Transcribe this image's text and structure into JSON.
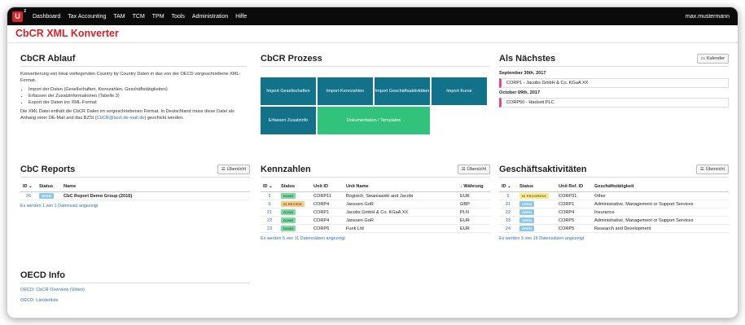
{
  "nav": {
    "logo": "U",
    "logo_sup": "2",
    "items": [
      "Dashboard",
      "Tax Accounting",
      "TAM",
      "TCM",
      "TPM",
      "Tools",
      "Administration",
      "Hilfe"
    ],
    "user": "max.mustermann"
  },
  "page_title": "CbCR XML Konverter",
  "ablauf": {
    "title": "CbCR Ablauf",
    "intro": "Konvertierung von lokal vorliegenden Country by Country Daten in das von der OECD vorgeschriebene XML-Format.",
    "steps": [
      "Import der Daten (Gesellschaften, Kennzahlen, Geschäftstätigkeiten)",
      "Erfassen der Zusatzinformationen (Tabelle 3)",
      "Export der Daten ins XML-Format"
    ],
    "outro_a": "Die XML Datei enthält die CbCR Daten im vorgeschriebenen Format. In Deutschland muss diese Datei als Anhang einer DE-Mail and das BZSt (",
    "outro_link": "CbCR@bzst.de-mail.de",
    "outro_b": ") geschickt werden."
  },
  "prozess": {
    "title": "CbCR Prozess",
    "tiles": [
      "Import Gesellschaften",
      "Import Kennzahlen",
      "Import Geschäftsaktivitäten",
      "Import Kurse",
      "Erfassen Zusatzinfo",
      "Dokumentation / Templates"
    ]
  },
  "naechstes": {
    "title": "Als Nächstes",
    "button": "Kalender",
    "groups": [
      {
        "date": "September 30th, 2017",
        "event": "CORP1 - Jacobs GmbH & Co. KGaA XX"
      },
      {
        "date": "October 09th, 2017",
        "event": "CORP50 - Hackett PLC"
      }
    ]
  },
  "reports": {
    "title": "CbC Reports",
    "button": "Übersicht",
    "columns": [
      "ID",
      "Status",
      "Name"
    ],
    "rows": [
      {
        "id": "26",
        "status": "OPEN",
        "name": "CbC Report Demo Group (2016)"
      }
    ],
    "footer": "Es werden 1 von 1 Datensatz angezeigt"
  },
  "kennzahlen": {
    "title": "Kennzahlen",
    "button": "Übersicht",
    "columns": [
      "ID",
      "Status",
      "Unit ID",
      "Unit Name",
      "Währung"
    ],
    "rows": [
      {
        "id": "5",
        "status": "DONE",
        "unit": "CORP11",
        "name": "Bogisich, Swaniawski and Jacobi",
        "cur": "EUR"
      },
      {
        "id": "6",
        "status": "IN REVIEW",
        "unit": "CORP4",
        "name": "Janssen GoR",
        "cur": "GBP"
      },
      {
        "id": "21",
        "status": "DONE",
        "unit": "CORP1",
        "name": "Jacobs GmbH & Co. KGaA XX",
        "cur": "PLN"
      },
      {
        "id": "22",
        "status": "DONE",
        "unit": "CORP4",
        "name": "Janssen GoR",
        "cur": "EUR"
      },
      {
        "id": "23",
        "status": "DONE",
        "unit": "CORP6",
        "name": "Funk Ltd",
        "cur": "EUR"
      }
    ],
    "footer": "Es werden 5 von 11 Datensätzen angezeigt"
  },
  "aktivitaeten": {
    "title": "Geschäftsaktivitäten",
    "button": "Übersicht",
    "columns": [
      "ID",
      "Status",
      "Unit Ref. ID",
      "Geschäftstätigkeit"
    ],
    "rows": [
      {
        "id": "5",
        "status": "IN PROGRESS",
        "unit": "CORP31",
        "act": "Other"
      },
      {
        "id": "21",
        "status": "OPEN",
        "unit": "CORP1",
        "act": "Administrative, Management or Support Services"
      },
      {
        "id": "22",
        "status": "OPEN",
        "unit": "CORP4",
        "act": "Insurance"
      },
      {
        "id": "23",
        "status": "OPEN",
        "unit": "CORP5",
        "act": "Administrative, Management or Support Services"
      },
      {
        "id": "24",
        "status": "OPEN",
        "unit": "CORP5",
        "act": "Research and Development"
      }
    ],
    "footer": "Es werden 5 von 16 Datensätzen angezeigt"
  },
  "oecd": {
    "title": "OECD Info",
    "links": [
      "OECD: CbCR Overview (Video)",
      "OECD: Länderliste"
    ]
  }
}
